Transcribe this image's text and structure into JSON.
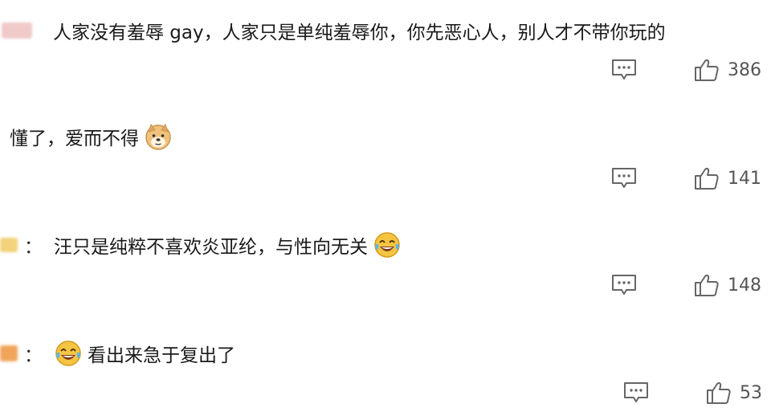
{
  "comments": [
    {
      "text": "人家没有羞辱 gay，人家只是单纯羞辱你，你先恶心人，别人才不带你玩的",
      "emoji": "",
      "likes": "386"
    },
    {
      "text": "懂了，爱而不得",
      "emoji": "doge-icon",
      "likes": "141"
    },
    {
      "prefix": "：",
      "text": "汪只是纯粹不喜欢炎亚纶，与性向无关",
      "emoji": "laugh-cry-icon",
      "likes": "148"
    },
    {
      "prefix": "：",
      "text": "看出来急于复出了",
      "emoji_before": "laugh-cry-icon",
      "likes": "53"
    }
  ],
  "colors": {
    "text": "#1a1a1a",
    "icon": "#666666",
    "emoji_yellow": "#f5c542"
  }
}
